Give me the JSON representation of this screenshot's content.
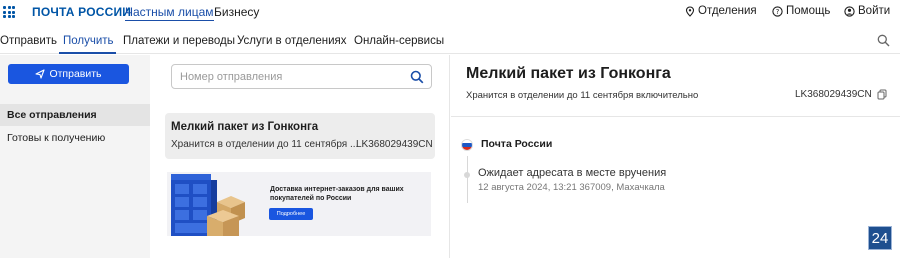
{
  "header": {
    "logo": "ПОЧТА РОССИИ",
    "nav": {
      "private": "Частным лицам",
      "business": "Бизнесу"
    },
    "right": {
      "offices": "Отделения",
      "help": "Помощь",
      "login": "Войти"
    }
  },
  "subnav": {
    "items": [
      "Отправить",
      "Получить",
      "Платежи и переводы",
      "Услуги в отделениях",
      "Онлайн-сервисы"
    ],
    "active_index": 1
  },
  "sidebar": {
    "send_button": "Отправить",
    "items": [
      {
        "label": "Все отправления",
        "active": true
      },
      {
        "label": "Готовы к получению",
        "active": false
      }
    ]
  },
  "search": {
    "placeholder": "Номер отправления",
    "value": ""
  },
  "shipment_card": {
    "title": "Мелкий пакет из Гонконга",
    "status": "Хранится в отделении до 11 сентября ...",
    "tracking": "LK368029439CN"
  },
  "banner": {
    "title": "Доставка интернет-заказов для ваших покупателей по России",
    "button": "Подробнее"
  },
  "detail": {
    "title": "Мелкий пакет из Гонконга",
    "status": "Хранится в отделении до 11 сентября включительно",
    "tracking": "LK368029439CN",
    "carrier": "Почта России",
    "event": {
      "title": "Ожидает адресата в месте вручения",
      "meta": "12 августа 2024, 13:21 367009, Махачкала"
    }
  },
  "badge": "24",
  "colors": {
    "brand": "#0055a6",
    "accent": "#1a56e0",
    "link": "#1a4ea8"
  },
  "icons": [
    "apps-grid-icon",
    "location-pin-icon",
    "help-circle-icon",
    "user-icon",
    "search-icon",
    "send-arrow-icon",
    "copy-icon",
    "russia-flag-icon"
  ]
}
